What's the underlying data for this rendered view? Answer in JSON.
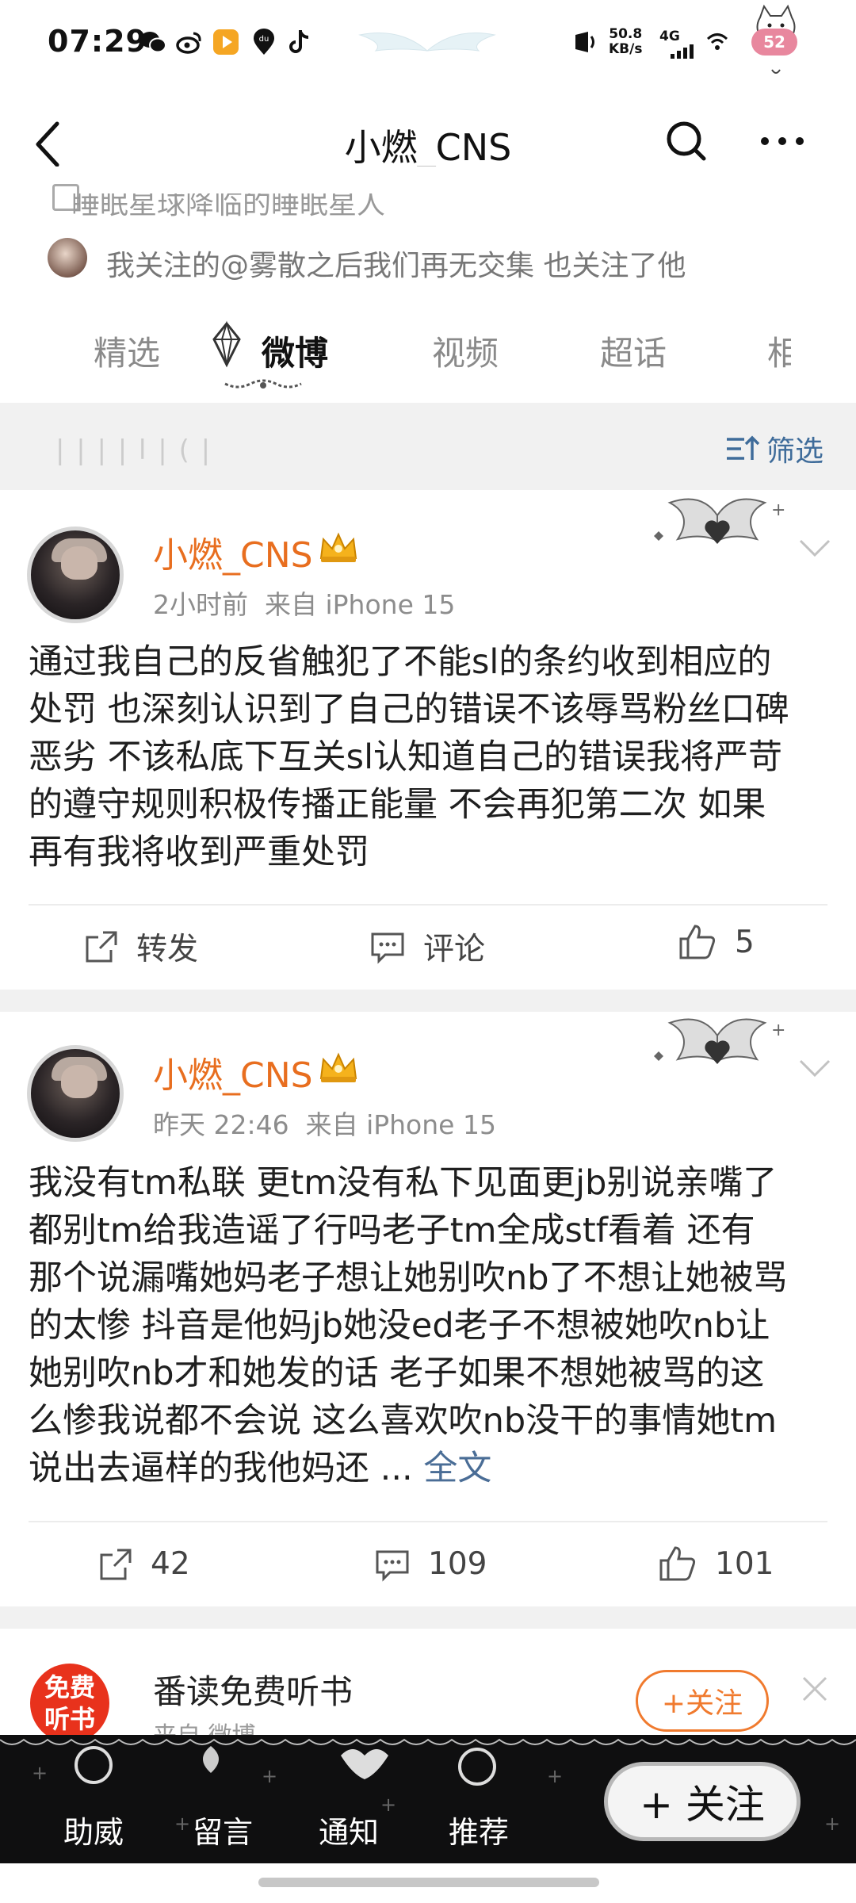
{
  "status_bar": {
    "time": "07:29",
    "net_speed": "50.8",
    "net_unit": "KB/s",
    "signal": "4G",
    "battery": "52"
  },
  "nav": {
    "title": "小燃_CNS"
  },
  "profile": {
    "line1": "睡眠星球降临的睡眠星人",
    "followed_by": "我关注的@雾散之后我们再无交集 也关注了他"
  },
  "tabs": [
    "精选",
    "微博",
    "视频",
    "超话",
    "相"
  ],
  "filter_bar": {
    "left_text": "| | | | l | ( |",
    "filter_label": "筛选"
  },
  "posts": [
    {
      "username": "小燃_CNS",
      "time": "2小时前",
      "source": "来自 iPhone 15",
      "lines": [
        "通过我自己的反省触犯了不能sl的条约收到相应的",
        "处罚 也深刻认识到了自己的错误不该辱骂粉丝口碑",
        "恶劣 不该私底下互关sl认知道自己的错误我将严苛",
        "的遵守规则积极传播正能量 不会再犯第二次 如果",
        "再有我将收到严重处罚"
      ],
      "more": "",
      "repost": "转发",
      "comment": "评论",
      "likes": "5"
    },
    {
      "username": "小燃_CNS",
      "time": "昨天 22:46",
      "source": "来自 iPhone 15",
      "lines": [
        "我没有tm私联 更tm没有私下见面更jb别说亲嘴了",
        "都别tm给我造谣了行吗老子tm全成stf看着  还有",
        "那个说漏嘴她妈老子想让她别吹nb了不想让她被骂",
        "的太惨 抖音是他妈jb她没ed老子不想被她吹nb让",
        "她别吹nb才和她发的话 老子如果不想她被骂的这",
        "么惨我说都不会说 这么喜欢吹nb没干的事情她tm",
        "说出去逼样的我他妈还 ..."
      ],
      "more": "全文",
      "repost": "42",
      "comment": "109",
      "likes": "101"
    }
  ],
  "ad": {
    "logo_line1": "免费",
    "logo_line2": "听书",
    "title": "番读免费听书",
    "sub": "来自 微博",
    "follow": "+关注"
  },
  "bottom_bar": {
    "items": [
      "助威",
      "留言",
      "通知",
      "推荐"
    ],
    "follow": "+ 关注"
  },
  "colors": {
    "username": "#e86e1f",
    "link": "#4a6d96",
    "filter": "#3f6c9a",
    "ad_follow": "#f07a2e"
  }
}
